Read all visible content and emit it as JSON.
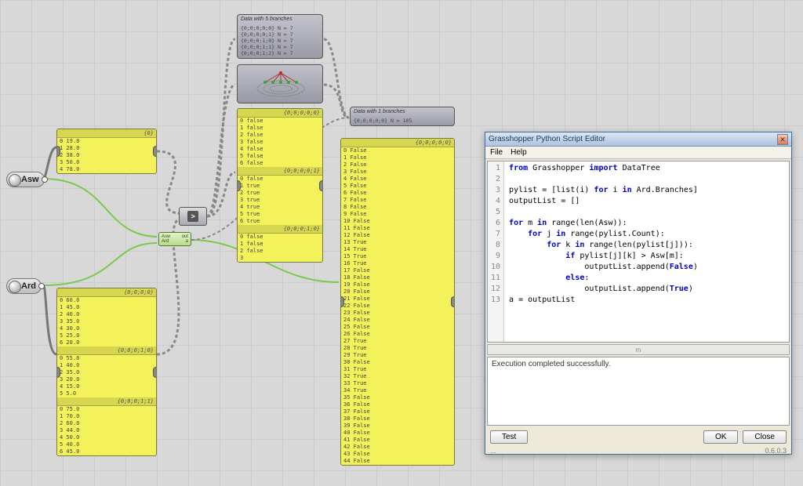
{
  "params": {
    "asw": "Asw",
    "ard": "Ard"
  },
  "panel_asw": {
    "hdr": "{0}",
    "rows": [
      "0 19.0",
      "1 28.0",
      "2 38.0",
      "3 50.0",
      "4 78.0"
    ]
  },
  "panel_ard_a": {
    "hdr": "{0;0;0;0}",
    "rows": [
      "0 60.0",
      "1 45.0",
      "2 40.0",
      "3 35.0",
      "4 30.0",
      "5 25.0",
      "6 20.0"
    ]
  },
  "panel_ard_b": {
    "hdr": "{0;0;0;1;0}",
    "rows": [
      "0 55.0",
      "1 40.0",
      "2 35.0",
      "3 20.0",
      "4 15.0",
      "5 5.0"
    ]
  },
  "panel_ard_c": {
    "hdr": "{0;0;0;1;1}",
    "rows": [
      "0 75.0",
      "1 70.0",
      "2 60.0",
      "3 44.0",
      "4 50.0",
      "5 40.0",
      "6 45.0"
    ]
  },
  "comp_tree5": {
    "title": "Data with 5 branches",
    "rows": [
      "{0;0;0;0;0}          N = 7",
      "{0;0;0;0;1}          N = 7",
      "{0;0;0;1;0}          N = 7",
      "{0;0;0;1;1}          N = 7",
      "{0;0;0;1;2}          N = 7"
    ]
  },
  "comp_tree1": {
    "title": "Data with 1 branches",
    "rows": [
      "{0;0;0;0;0}          N = 105"
    ]
  },
  "panel_mid_a": {
    "hdr": "{0;0;0;0;0}",
    "rows": [
      "0 false",
      "1 false",
      "2 false",
      "3 false",
      "4 false",
      "5 false",
      "6 false"
    ]
  },
  "panel_mid_b": {
    "hdr": "{0;0;0;0;1}",
    "rows": [
      "0 false",
      "1 true",
      "2 true",
      "3 true",
      "4 true",
      "5 true",
      "6 true"
    ]
  },
  "panel_mid_c": {
    "hdr": "{0;0;0;1;0}",
    "rows": [
      "0 false",
      "1 false",
      "2 false",
      "3"
    ]
  },
  "panel_big": {
    "hdr": "{0;0;0;0;0}",
    "rows": [
      "0 False",
      "1 False",
      "2 False",
      "3 False",
      "4 False",
      "5 False",
      "6 False",
      "7 False",
      "8 False",
      "9 False",
      "10 False",
      "11 False",
      "12 False",
      "13 True",
      "14 True",
      "15 True",
      "16 True",
      "17 False",
      "18 False",
      "19 False",
      "20 False",
      "21 False",
      "22 False",
      "23 False",
      "24 False",
      "25 False",
      "26 False",
      "27 True",
      "28 True",
      "29 True",
      "30 False",
      "31 True",
      "32 True",
      "33 True",
      "34 True",
      "35 False",
      "36 False",
      "37 False",
      "38 False",
      "39 False",
      "40 False",
      "41 False",
      "42 False",
      "43 False",
      "44 False"
    ]
  },
  "lt_label": ">",
  "pynode": {
    "in1": "Asw",
    "in2": "Ard",
    "out_label": "out",
    "a": "a"
  },
  "editor": {
    "title": "Grasshopper Python Script Editor",
    "menu": [
      "File",
      "Help"
    ],
    "gutter": "1\n2\n3\n4\n5\n6\n7\n8\n9\n10\n11\n12\n13",
    "status": "Execution completed successfully.",
    "btn_test": "Test",
    "btn_ok": "OK",
    "btn_close": "Close",
    "version": "0.6.0.3",
    "menu_ellipsis": "...",
    "scroll_label": "m",
    "close_glyph": "✕",
    "code": {
      "l1a": "from",
      "l1b": " Grasshopper ",
      "l1c": "import",
      "l1d": " DataTree",
      "l2": "",
      "l3a": "pylist = [list(i) ",
      "l3b": "for",
      "l3c": " i ",
      "l3d": "in",
      "l3e": " Ard.Branches]",
      "l4": "outputList = []",
      "l5": "",
      "l6a": "for",
      "l6b": " m ",
      "l6c": "in",
      "l6d": " range(len(Asw)):",
      "l7a": "    for",
      "l7b": " j ",
      "l7c": "in",
      "l7d": " range(pylist.Count):",
      "l8a": "        for",
      "l8b": " k ",
      "l8c": "in",
      "l8d": " range(len(pylist[j])):",
      "l9a": "            if",
      "l9b": " pylist[j][k] > Asw[m]:",
      "l10a": "                outputList.append(",
      "l10b": "False",
      "l10c": ")",
      "l11a": "            else",
      "l11b": ":",
      "l12a": "                outputList.append(",
      "l12b": "True",
      "l12c": ")",
      "l13": "a = outputList"
    }
  }
}
